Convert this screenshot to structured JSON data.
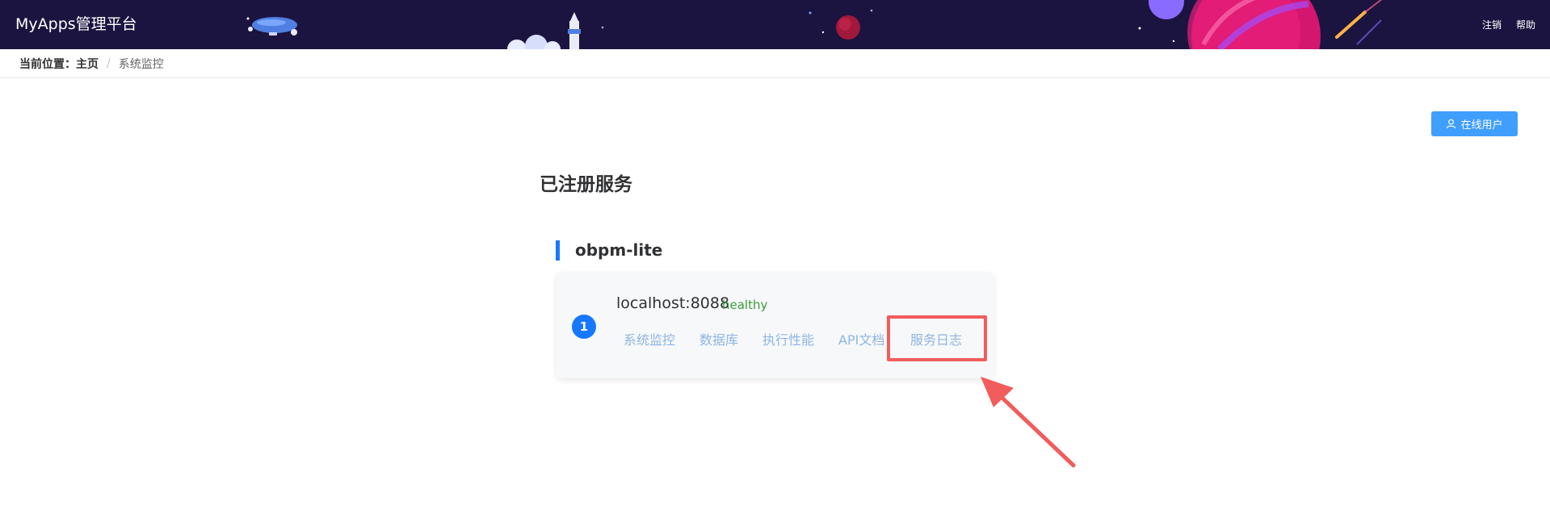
{
  "header": {
    "title": "MyApps管理平台",
    "links": [
      "注销",
      "帮助"
    ]
  },
  "breadcrumb": {
    "prefix": "当前位置：",
    "home": "主页",
    "separator": "/",
    "current": "系统监控"
  },
  "toolbar": {
    "online_users_label": "在线用户",
    "online_users_icon": "user-icon"
  },
  "main": {
    "section_title": "已注册服务",
    "service": {
      "name": "obpm-lite",
      "instances": [
        {
          "index": "1",
          "host": "localhost:8088",
          "status": "healthy",
          "links": [
            "系统监控",
            "数据库",
            "执行性能",
            "API文档",
            "服务日志"
          ]
        }
      ]
    }
  },
  "colors": {
    "header_bg": "#1c1440",
    "accent": "#1677ff",
    "button": "#409eff",
    "status_ok": "#3a9d3a",
    "highlight": "#f25c5c"
  }
}
